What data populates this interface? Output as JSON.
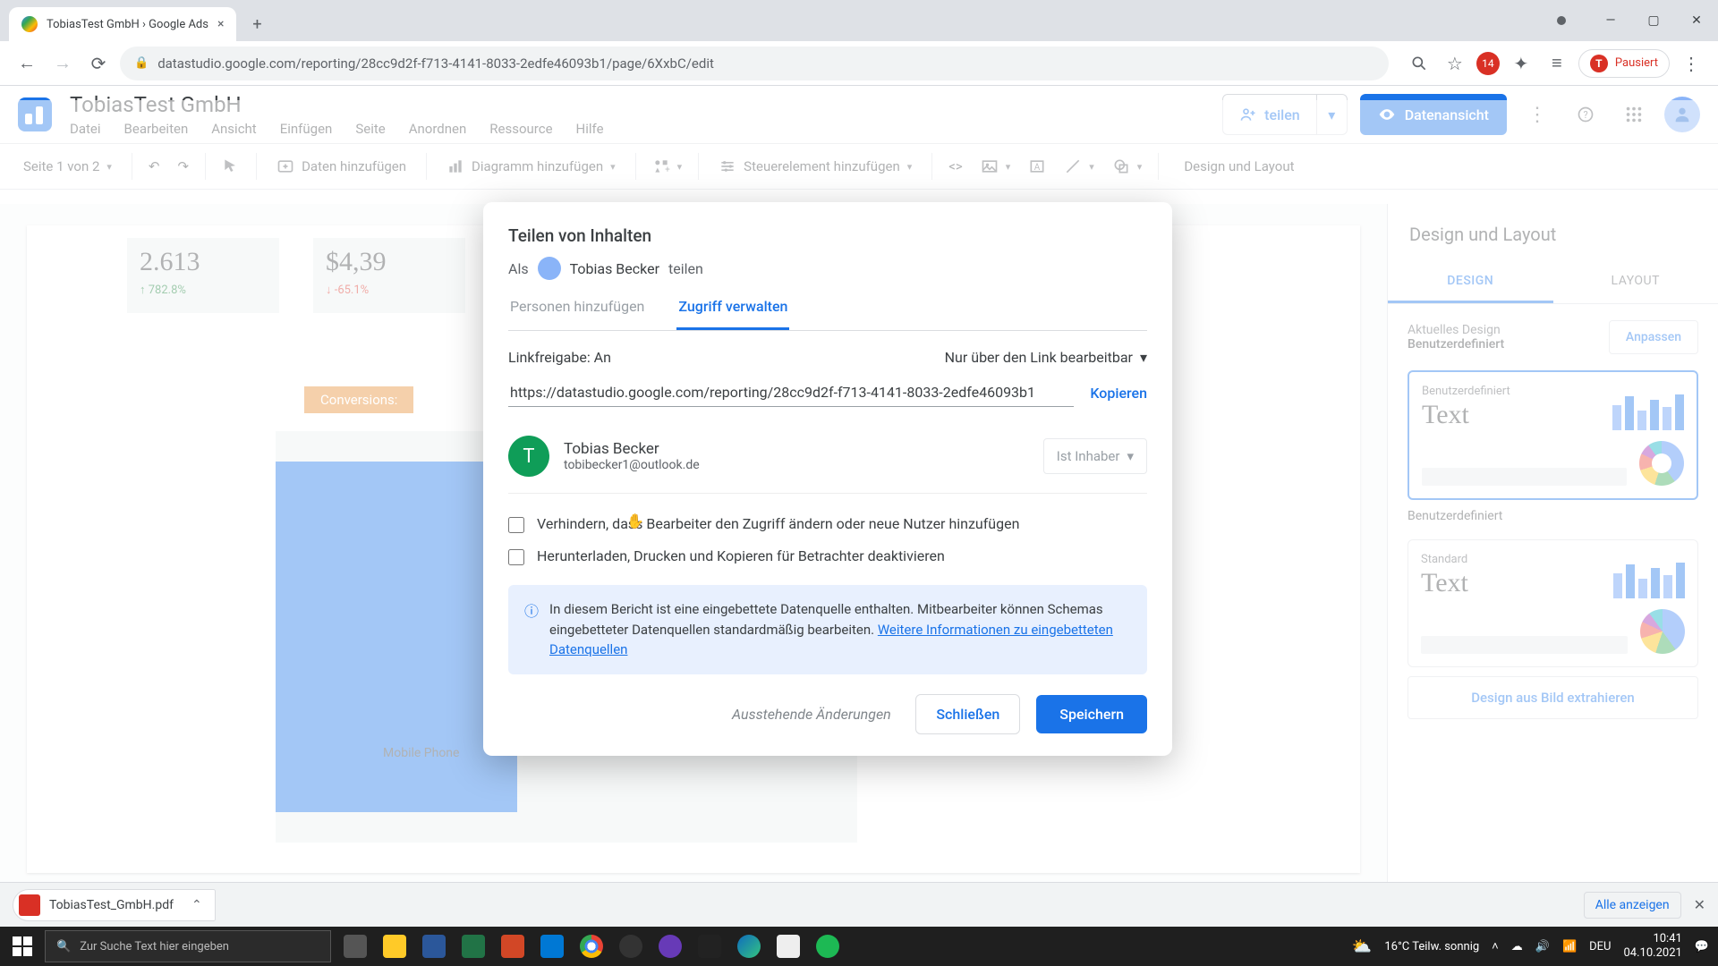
{
  "browser": {
    "tab_title": "TobiasTest GmbH › Google Ads",
    "url": "datastudio.google.com/reporting/28cc9d2f-f713-4141-8033-2edfe46093b1/page/6XxbC/edit",
    "profile_label": "Pausiert"
  },
  "app": {
    "title": "TobiasTest GmbH",
    "menu": [
      "Datei",
      "Bearbeiten",
      "Ansicht",
      "Einfügen",
      "Seite",
      "Anordnen",
      "Ressource",
      "Hilfe"
    ],
    "share_label": "teilen",
    "view_label": "Datenansicht"
  },
  "toolbar": {
    "page_label": "Seite 1 von 2",
    "add_data": "Daten hinzufügen",
    "add_chart": "Diagramm hinzufügen",
    "add_control": "Steuerelement hinzufügen",
    "right_label": "Design und Layout"
  },
  "canvas": {
    "score1": {
      "value": "2.613",
      "delta": "↑ 782.8%"
    },
    "score2": {
      "value": "$4,39",
      "delta": "↓ -65.1%"
    },
    "conversions_label": "Conversions:",
    "device_label": "Mobile Phone"
  },
  "panel": {
    "title": "Design und Layout",
    "tab_design": "DESIGN",
    "tab_layout": "LAYOUT",
    "current_label": "Aktuelles Design",
    "current_value": "Benutzerdefiniert",
    "customize_btn": "Anpassen",
    "theme1_name": "Benutzerdefiniert",
    "theme1_text": "Text",
    "theme1_label": "Benutzerdefiniert",
    "theme2_name": "Standard",
    "theme2_text": "Text",
    "extract_btn": "Design aus Bild extrahieren"
  },
  "dialog": {
    "title": "Teilen von Inhalten",
    "as_prefix": "Als",
    "as_name": "Tobias Becker",
    "as_suffix": "teilen",
    "tab_add": "Personen hinzufügen",
    "tab_manage": "Zugriff verwalten",
    "link_sharing_label": "Linkfreigabe: An",
    "permission_label": "Nur über den Link bearbeitbar",
    "url": "https://datastudio.google.com/reporting/28cc9d2f-f713-4141-8033-2edfe46093b1",
    "copy_label": "Kopieren",
    "person_name": "Tobias Becker",
    "person_email": "tobibecker1@outlook.de",
    "person_initial": "T",
    "owner_label": "Ist Inhaber",
    "check1": "Verhindern, dass Bearbeiter den Zugriff ändern oder neue Nutzer hinzufügen",
    "check2": "Herunterladen, Drucken und Kopieren für Betrachter deaktivieren",
    "info_text": "In diesem Bericht ist eine eingebettete Datenquelle enthalten. Mitbearbeiter können Schemas eingebetteter Datenquellen standardmäßig bearbeiten. ",
    "info_link": "Weitere Informationen zu eingebetteten Datenquellen",
    "pending": "Ausstehende Änderungen",
    "close_btn": "Schließen",
    "save_btn": "Speichern"
  },
  "downloads": {
    "file": "TobiasTest_GmbH.pdf",
    "show_all": "Alle anzeigen"
  },
  "taskbar": {
    "search_placeholder": "Zur Suche Text hier eingeben",
    "weather": "16°C  Teilw. sonnig",
    "time": "10:41",
    "date": "04.10.2021"
  }
}
